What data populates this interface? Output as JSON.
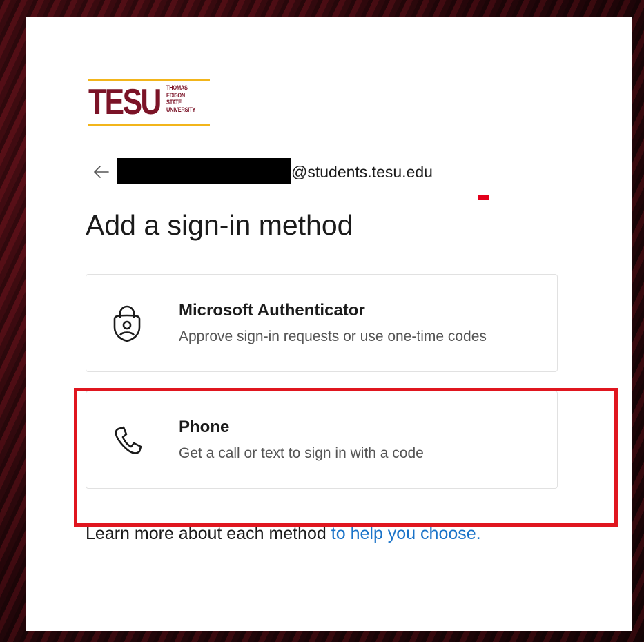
{
  "logo": {
    "wordmark": "TESU",
    "line1": "THOMAS",
    "line2": "EDISON",
    "line3": "STATE",
    "line4": "UNIVERSITY"
  },
  "header": {
    "back_icon": "arrow-left-icon",
    "email_suffix": "@students.tesu.edu"
  },
  "title": "Add a sign-in method",
  "options": [
    {
      "icon": "authenticator-lock-icon",
      "name": "Microsoft Authenticator",
      "description": "Approve sign-in requests or use one-time codes"
    },
    {
      "icon": "phone-icon",
      "name": "Phone",
      "description": "Get a call or text to sign in with a code"
    }
  ],
  "footer": {
    "text": "Learn more about each method ",
    "link": "to help you choose."
  },
  "colors": {
    "brand": "#7b1327",
    "gold": "#f2b51b",
    "link": "#1a73c8",
    "highlight": "#e0161f"
  }
}
